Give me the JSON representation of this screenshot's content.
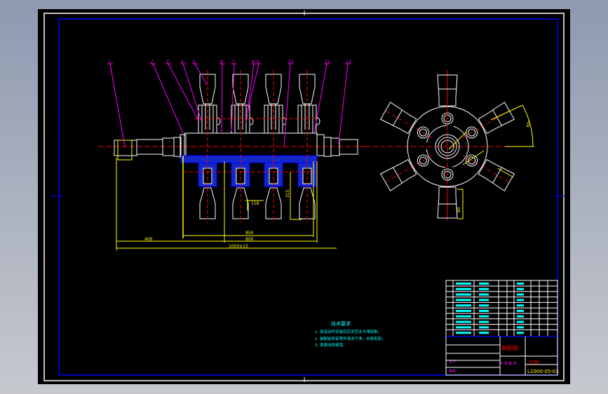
{
  "colors": {
    "background": "#000000",
    "frame": "#ffffff",
    "border": "#0000ff",
    "outline": "#ffffff",
    "centerline": "#ff0000",
    "dimension": "#ffff00",
    "leader": "#ff00ff",
    "hatch": "#0000ff",
    "table_text": "#00ffff",
    "title_text": "#ff0000"
  },
  "balloons": [
    "1",
    "2",
    "3",
    "4",
    "5",
    "6",
    "7",
    "8",
    "9",
    "10",
    "11",
    "12",
    "13"
  ],
  "dimensions": {
    "left_len": "400",
    "inner_len": "850",
    "mid_len": "800",
    "total_len": "1050±15",
    "lower_offset": "118",
    "lower_height": "315",
    "angle": "60°",
    "hopper_width": "80"
  },
  "notes": {
    "title": "技术要求",
    "lines": [
      "1. 各运动件安装后应灵活无卡滞现象。",
      "2. 装配前所有零件清洗干净，去除毛刺。",
      "3. 表面涂防锈漆。"
    ]
  },
  "title_block": {
    "drawing_title": "装配图",
    "drawing_number": "L1000-05-03",
    "scale_label": "比例",
    "sheet_label": "共 张 第 张",
    "design_label": "设计",
    "check_label": "审核"
  }
}
